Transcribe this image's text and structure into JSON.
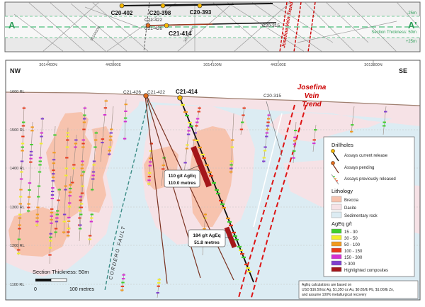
{
  "plan": {
    "holes": [
      "C20-402",
      "C20-398",
      "C20-393",
      "C21-422",
      "C21-426",
      "C21-414",
      "C20-315"
    ],
    "labels": {
      "A": "A",
      "A_prime": "A'",
      "neg25": "-25m",
      "pos25": "+25m",
      "section_thickness": "Section Thickness: 50m"
    },
    "northings": [
      "3014400N",
      "3014100N"
    ],
    "vein": "Josefina Vein Trend"
  },
  "section": {
    "compass": {
      "left": "NW",
      "right": "SE"
    },
    "eastings": [
      "3014400N",
      "442800E",
      "3014100N",
      "443100E",
      "3013800N"
    ],
    "rl_labels": [
      "1600 RL",
      "1500 RL",
      "1400 RL",
      "1300 RL",
      "1200 RL",
      "1100 RL"
    ],
    "holes": {
      "c21_426": "C21-426",
      "c21_422": "C21-422",
      "c21_414": "C21-414",
      "c20_315": "C20-315"
    },
    "vein_title": [
      "Josefina",
      "Vein",
      "Trend"
    ],
    "fault_label": "CORDERO FAULT",
    "callouts": [
      {
        "grade": "110 g/t AgEq",
        "length": "110.0 metres"
      },
      {
        "grade": "184 g/t AgEq",
        "length": "51.8 metres"
      }
    ],
    "section_thickness": "Section Thickness: 50m",
    "scale": {
      "zero": "0",
      "end": "100 metres"
    }
  },
  "legend": {
    "drillholes_title": "Drillholes",
    "drillholes": [
      "Assays current release",
      "Assays pending",
      "Assays previously released"
    ],
    "lithology_title": "Lithology",
    "lithology": [
      {
        "label": "Breccia",
        "color": "#f7c3ae"
      },
      {
        "label": "Dacite",
        "color": "#f6e2e6"
      },
      {
        "label": "Sedimentary rock",
        "color": "#dcecf3"
      }
    ],
    "grade_title": "AgEq g/t",
    "grades": [
      {
        "label": "15 - 30",
        "color": "#3fcf2e"
      },
      {
        "label": "30 - 50",
        "color": "#f2ee2a"
      },
      {
        "label": "50 - 100",
        "color": "#f29a1e"
      },
      {
        "label": "100 - 150",
        "color": "#e83a1c"
      },
      {
        "label": "150 - 300",
        "color": "#d52fd3"
      },
      {
        "label": "> 300",
        "color": "#7f3fcf"
      },
      {
        "label": "Highlighted composites",
        "color": "#a4161a"
      }
    ]
  },
  "note": [
    "AgEq calculations are based on",
    "USD $16.50/oz Ag, $1,350 oz Au, $0.85/lb Pb, $1.00/lb Zn,",
    "and assume 100% metallurgical recovery"
  ]
}
